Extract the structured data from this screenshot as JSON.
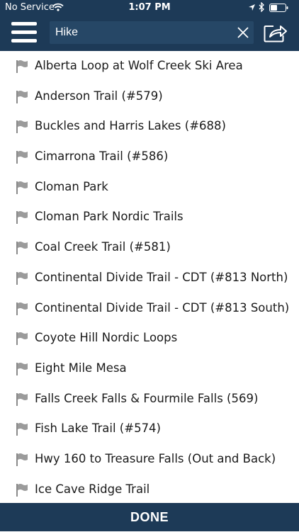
{
  "status_bar": {
    "carrier": "No Service",
    "time": "1:07 PM"
  },
  "search": {
    "value": "Hike"
  },
  "icons": {
    "menu": "hamburger-menu-icon",
    "clear": "close-icon",
    "share": "share-icon",
    "list_item": "flag-icon"
  },
  "colors": {
    "header_background": "#1d3a57",
    "search_background": "#264766",
    "flag": "#9b9b9b"
  },
  "trails": [
    {
      "label": "Alberta Loop at Wolf Creek  Ski Area"
    },
    {
      "label": "Anderson Trail (#579)"
    },
    {
      "label": "Buckles and Harris Lakes (#688)"
    },
    {
      "label": "Cimarrona Trail (#586)"
    },
    {
      "label": "Cloman Park"
    },
    {
      "label": "Cloman Park Nordic Trails"
    },
    {
      "label": "Coal Creek Trail (#581)"
    },
    {
      "label": "Continental Divide Trail - CDT (#813 North)"
    },
    {
      "label": "Continental Divide Trail - CDT (#813 South)"
    },
    {
      "label": "Coyote Hill Nordic Loops"
    },
    {
      "label": "Eight Mile Mesa"
    },
    {
      "label": "Falls Creek Falls & Fourmile Falls (569)"
    },
    {
      "label": "Fish Lake Trail (#574)"
    },
    {
      "label": "Hwy 160 to Treasure Falls (Out and Back)"
    },
    {
      "label": "Ice Cave Ridge Trail"
    }
  ],
  "footer": {
    "done_label": "DONE"
  }
}
